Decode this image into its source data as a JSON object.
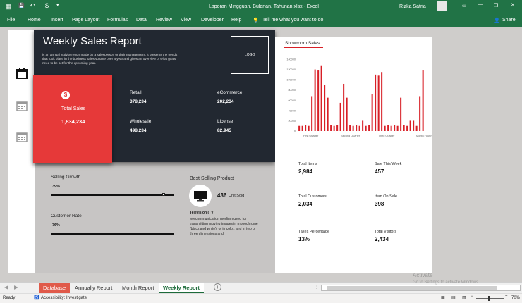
{
  "window": {
    "file_title": "Laporan Mingguan, Bulanan, Tahunan.xlsx  -  Excel",
    "search_hint": "Tell me what you want to do",
    "user_name": "Rizka Satria",
    "share_label": "Share"
  },
  "ribbon_tabs": [
    "File",
    "Home",
    "Insert",
    "Page Layout",
    "Formulas",
    "Data",
    "Review",
    "View",
    "Developer",
    "Help"
  ],
  "report": {
    "title": "Weekly Sales Report",
    "description": "is an annual activity report made by a salesperson or their management. it presents the trends that took place in the business sales volume over a year and gives an overview of what goals need to be set for the upcoming year.",
    "logo_label": "LOGO",
    "total_sales_label": "Total Sales",
    "total_sales_value": "1,834,234",
    "retail_label": "Retail",
    "retail_value": "378,234",
    "ecommerce_label": "eCommerce",
    "ecommerce_value": "202,234",
    "wholesale_label": "Wholesale",
    "wholesale_value": "498,234",
    "license_label": "License",
    "license_value": "82,945",
    "selling_growth_label": "Selling Growth",
    "selling_growth_value": "39%",
    "selling_growth_fraction": 0.39,
    "customer_rate_label": "Customer Rate",
    "customer_rate_value": "76%",
    "customer_rate_fraction": 0.76,
    "best_product_label": "Best Selling Product",
    "best_product_units": "436",
    "best_product_units_label": "Unit Sold",
    "best_product_name": "Television (TV)",
    "best_product_desc": "telecommunication medium used for transmitting moving images in monochrome (black and white), or in color, and in two or three dimensions and"
  },
  "right_panel": {
    "chart_title": "Showroom Sales",
    "stats": [
      {
        "label": "Total Items",
        "value": "2,984"
      },
      {
        "label": "Sale This Week",
        "value": "457"
      },
      {
        "label": "Total Customers",
        "value": "2,034"
      },
      {
        "label": "Item On Sale",
        "value": "398"
      },
      {
        "label": "Taxes Percentage",
        "value": "13%"
      },
      {
        "label": "Total Visitors",
        "value": "2,434"
      }
    ]
  },
  "chart_data": {
    "type": "bar",
    "title": "Showroom Sales",
    "x_tick_labels": [
      "First Quarter",
      "Second Quarter",
      "Third Quarter",
      "Month Fourth"
    ],
    "ylim": [
      0,
      140000
    ],
    "y_ticks": [
      0,
      20000,
      40000,
      60000,
      80000,
      100000,
      120000,
      140000
    ],
    "bar_color": "#d81f26",
    "values": [
      10000,
      10000,
      12000,
      10000,
      68000,
      120000,
      118000,
      128000,
      90000,
      65000,
      12000,
      10000,
      12000,
      55000,
      92000,
      65000,
      12000,
      10000,
      12000,
      10000,
      20000,
      10000,
      12000,
      72000,
      110000,
      108000,
      115000,
      10000,
      12000,
      10000,
      12000,
      10000,
      65000,
      12000,
      10000,
      20000,
      20000,
      10000,
      68000,
      118000
    ]
  },
  "sheet_tabs": [
    "Database",
    "Annually Report",
    "Month Report",
    "Weekly Report"
  ],
  "active_tab": "Weekly Report",
  "status": {
    "ready": "Ready",
    "accessibility": "Accessibility: Investigate",
    "zoom": "70%",
    "watermark_line1": "Activate",
    "watermark_line2": "Go to Settings to activate Windows."
  },
  "colors": {
    "excel_green": "#217346",
    "accent_red": "#e63939",
    "dark_panel": "#222831"
  }
}
